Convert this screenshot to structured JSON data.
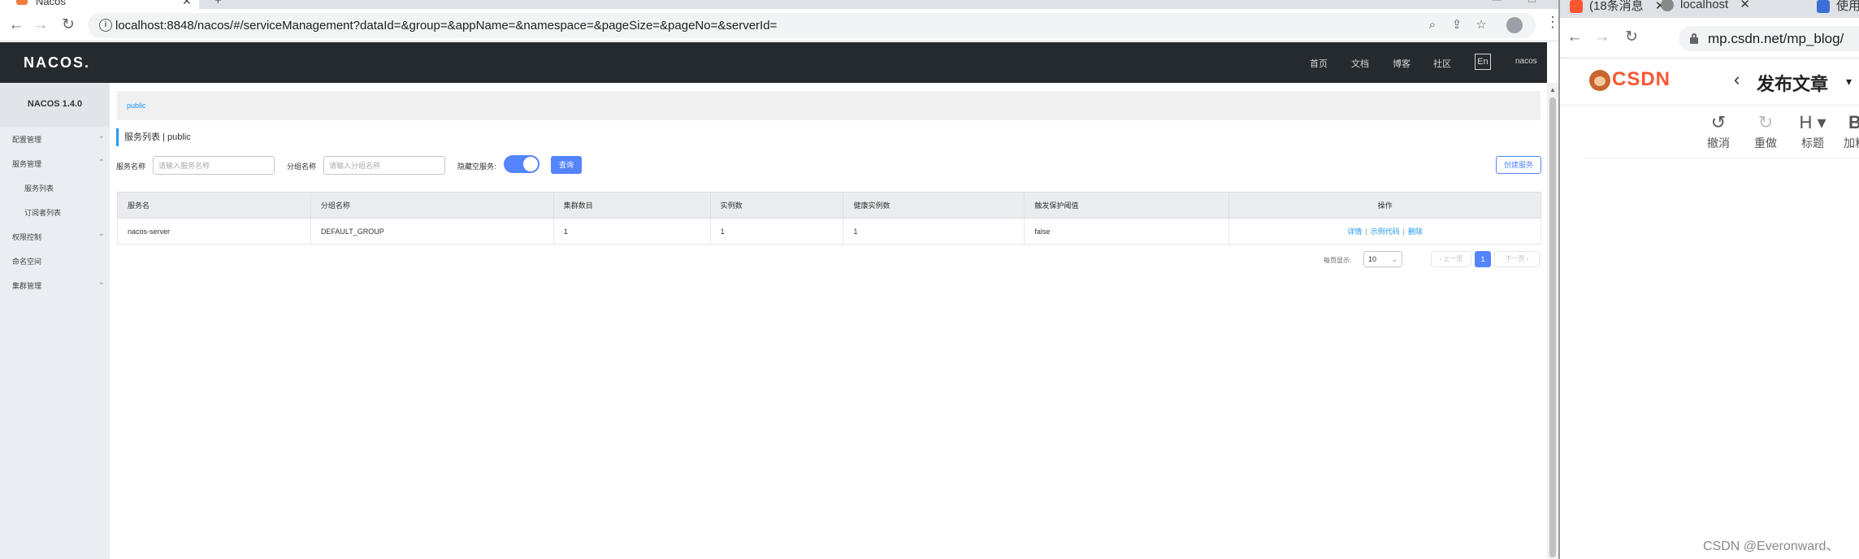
{
  "left_browser": {
    "tab": {
      "title": "Nacos",
      "close": "✕",
      "new_tab": "+"
    },
    "window_controls": {
      "minimize": "—",
      "maximize": "☐"
    },
    "url": "localhost:8848/nacos/#/serviceManagement?dataId=&group=&appName=&namespace=&pageSize=&pageNo=&serverId="
  },
  "nacos": {
    "logo": "NACOS.",
    "nav": [
      "首页",
      "文档",
      "博客",
      "社区"
    ],
    "lang": "En",
    "user": "nacos",
    "sidebar": {
      "title": "NACOS 1.4.0",
      "items": [
        {
          "label": "配置管理",
          "chevron": "⌄"
        },
        {
          "label": "服务管理",
          "chevron": "⌃"
        },
        {
          "label": "服务列表"
        },
        {
          "label": "订阅者列表"
        },
        {
          "label": "权限控制",
          "chevron": "⌄"
        },
        {
          "label": "命名空间"
        },
        {
          "label": "集群管理",
          "chevron": "⌄"
        }
      ]
    },
    "namespace": "public",
    "page_title": "服务列表 | public",
    "filters": {
      "service_name_label": "服务名称",
      "service_name_placeholder": "请输入服务名称",
      "group_name_label": "分组名称",
      "group_name_placeholder": "请输入分组名称",
      "hide_empty_label": "隐藏空服务:",
      "hide_empty_on": true,
      "query_button": "查询",
      "create_button": "创建服务"
    },
    "table": {
      "headers": [
        "服务名",
        "分组名称",
        "集群数目",
        "实例数",
        "健康实例数",
        "触发保护阈值",
        "操作"
      ],
      "rows": [
        {
          "cells": [
            "nacos-server",
            "DEFAULT_GROUP",
            "1",
            "1",
            "1",
            "false"
          ],
          "actions": [
            "详情",
            "示例代码",
            "删除"
          ]
        }
      ],
      "action_separator": "|"
    },
    "pagination": {
      "page_size_label": "每页显示:",
      "page_size": "10",
      "prev": "‹ 上一页",
      "next": "下一页 ›",
      "current_page": "1"
    }
  },
  "right_browser": {
    "tabs": [
      "(18条消息",
      "localhost",
      "使用"
    ],
    "tab_close": "✕",
    "url": "mp.csdn.net/mp_blog/",
    "csdn": {
      "logo": "CSDN",
      "back": "‹",
      "heading": "发布文章",
      "caret": "▾",
      "tools": [
        {
          "icon": "↺",
          "label": "撤消"
        },
        {
          "icon": "↻",
          "label": "重做"
        },
        {
          "icon": "H ▾",
          "label": "标题"
        },
        {
          "icon": "B",
          "label": "加粗"
        }
      ]
    },
    "watermark": "CSDN @Everonward、"
  }
}
